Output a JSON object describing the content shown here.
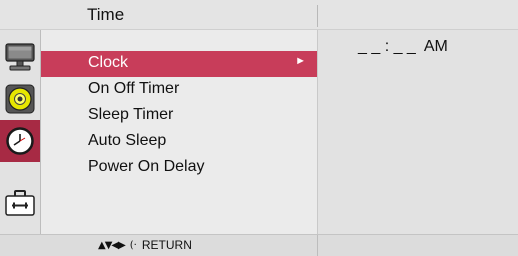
{
  "header": {
    "title": "Time"
  },
  "rail": {
    "icons": [
      {
        "name": "monitor-icon",
        "active": false
      },
      {
        "name": "audio-disc-icon",
        "active": false
      },
      {
        "name": "clock-icon",
        "active": true
      },
      {
        "name": "toolbox-icon",
        "active": false
      }
    ]
  },
  "menu": {
    "items": [
      {
        "label": "Clock",
        "selected": true,
        "arrow": "►"
      },
      {
        "label": "On Off Timer",
        "selected": false
      },
      {
        "label": "Sleep Timer",
        "selected": false
      },
      {
        "label": "Auto Sleep",
        "selected": false
      },
      {
        "label": "Power On Delay",
        "selected": false
      }
    ]
  },
  "value": {
    "time": "_ _ : _ _  AM"
  },
  "footer": {
    "nav_arrows": "▲▼◀▶",
    "enter_symbol": "(·",
    "return_label": "RETURN"
  },
  "colors": {
    "selected": "#c83d5a",
    "active_icon_bg": "#a72a44",
    "panel": "#ebebeb"
  }
}
